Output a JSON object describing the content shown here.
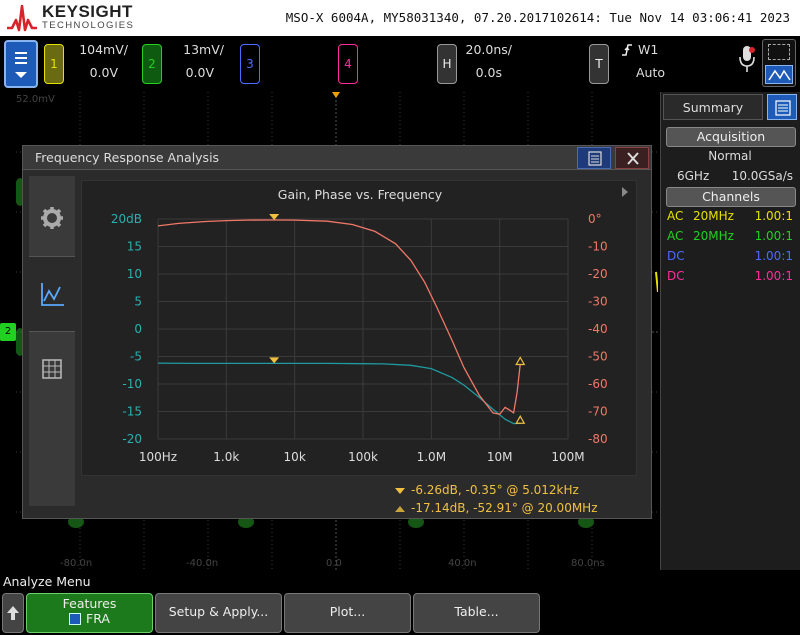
{
  "header": {
    "brand": "KEYSIGHT",
    "brand_sub": "TECHNOLOGIES",
    "model_info": "MSO-X 6004A, MY58031340, 07.20.2017102614: Tue Nov 14 03:06:41 2023"
  },
  "channels": [
    {
      "num": "1",
      "scale": "104mV/",
      "offset": "0.0V",
      "color": "#e8e000"
    },
    {
      "num": "2",
      "scale": "13mV/",
      "offset": "0.0V",
      "color": "#22d022"
    },
    {
      "num": "3",
      "color": "#4a6cff"
    },
    {
      "num": "4",
      "color": "#ff2d9b"
    }
  ],
  "horizontal": {
    "key": "H",
    "scale": "20.0ns/",
    "position": "0.0s"
  },
  "trigger": {
    "key": "T",
    "source": "W1",
    "mode": "Auto"
  },
  "grid": {
    "top_label": "52.0mV",
    "ch_marker": "2",
    "time_labels": [
      "-80.0n",
      "-40.0n",
      "0.0",
      "40.0n",
      "80.0ns"
    ]
  },
  "right_panel": {
    "tab": "Summary",
    "acquisition_label": "Acquisition",
    "acq_mode": "Normal",
    "bandwidth": "6GHz",
    "sample_rate": "10.0GSa/s",
    "channels_label": "Channels",
    "rows": [
      {
        "coupling": "AC",
        "bw": "20MHz",
        "probe": "1.00:1",
        "color": "#e8e000"
      },
      {
        "coupling": "AC",
        "bw": "20MHz",
        "probe": "1.00:1",
        "color": "#22d022"
      },
      {
        "coupling": "DC",
        "bw": "",
        "probe": "1.00:1",
        "color": "#4a6cff"
      },
      {
        "coupling": "DC",
        "bw": "",
        "probe": "1.00:1",
        "color": "#ff2d9b"
      }
    ]
  },
  "fra": {
    "title": "Frequency Response Analysis",
    "plot_title": "Gain, Phase vs. Frequency",
    "marker1": "-6.26dB, -0.35° @ 5.012kHz",
    "marker2": "-17.14dB, -52.91° @ 20.00MHz"
  },
  "chart_data": {
    "type": "line",
    "title": "Gain, Phase vs. Frequency",
    "x_tick_labels": [
      "100Hz",
      "1.0k",
      "10k",
      "100k",
      "1.0M",
      "10M",
      "100M"
    ],
    "x_scale": "log",
    "xlim": [
      100,
      100000000
    ],
    "y_left_ticks": [
      "20dB",
      "15",
      "10",
      "5",
      "0",
      "-5",
      "-10",
      "-15",
      "-20"
    ],
    "y_left_range": [
      -20,
      20
    ],
    "y_right_ticks": [
      "0°",
      "-10",
      "-20",
      "-30",
      "-40",
      "-50",
      "-60",
      "-70",
      "-80"
    ],
    "y_right_range": [
      -80,
      0
    ],
    "series": [
      {
        "color": "#1f9aa0",
        "axis": "left",
        "x": [
          100,
          300,
          1000,
          3000,
          10000,
          30000,
          100000,
          200000,
          500000,
          1000000,
          2000000,
          3000000,
          5000000,
          8000000,
          12000000,
          16000000,
          20000000
        ],
        "y": [
          -6.2,
          -6.25,
          -6.26,
          -6.26,
          -6.26,
          -6.26,
          -6.3,
          -6.35,
          -6.6,
          -7.2,
          -8.8,
          -10.2,
          -12.4,
          -14.6,
          -16.4,
          -17.2,
          -17.14
        ]
      },
      {
        "color": "#f07868",
        "axis": "right",
        "x": [
          100,
          200,
          500,
          1000,
          2000,
          5000,
          10000,
          30000,
          70000,
          150000,
          300000,
          500000,
          800000,
          1200000,
          2000000,
          3000000,
          5000000,
          8000000,
          10000000,
          12000000,
          14000000,
          16000000,
          18000000,
          20000000
        ],
        "y": [
          -2.5,
          -1.6,
          -0.9,
          -0.6,
          -0.4,
          -0.35,
          -0.4,
          -0.8,
          -2.0,
          -4.5,
          -9.0,
          -15.0,
          -23.0,
          -32.0,
          -44.0,
          -54.0,
          -64.0,
          -70.5,
          -71.0,
          -68.5,
          -69.5,
          -70.5,
          -63.0,
          -52.91
        ]
      }
    ],
    "markers": [
      {
        "symbol": "filled-triangle",
        "x": 5012,
        "gain": -6.26,
        "phase": -0.35
      },
      {
        "symbol": "open-triangle",
        "x": 20000000,
        "gain": -17.14,
        "phase": -52.91
      }
    ]
  },
  "bottom": {
    "menu_label": "Analyze Menu",
    "features_label": "Features",
    "features_value": "FRA",
    "setup_label": "Setup & Apply...",
    "plot_label": "Plot...",
    "table_label": "Table..."
  }
}
